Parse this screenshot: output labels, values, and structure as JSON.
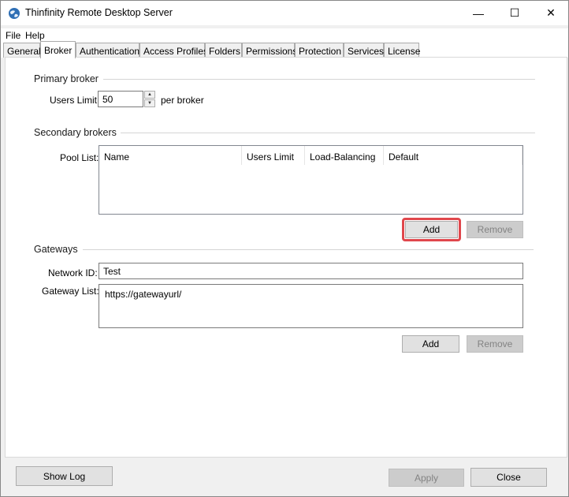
{
  "window": {
    "title": "Thinfinity Remote Desktop Server",
    "icon": "thinfinity-globe-icon",
    "controls": {
      "minimize": "—",
      "maximize": "☐",
      "close": "✕"
    }
  },
  "menu": [
    {
      "label": "File"
    },
    {
      "label": "Help"
    }
  ],
  "tabs": [
    {
      "label": "General"
    },
    {
      "label": "Broker",
      "active": true
    },
    {
      "label": "Authentication"
    },
    {
      "label": "Access Profiles"
    },
    {
      "label": "Folders"
    },
    {
      "label": "Permissions"
    },
    {
      "label": "Protection"
    },
    {
      "label": "Services"
    },
    {
      "label": "License"
    }
  ],
  "primary_broker": {
    "heading": "Primary broker",
    "users_limit_label": "Users Limit:",
    "users_limit_value": "50",
    "suffix": "per broker"
  },
  "secondary_brokers": {
    "heading": "Secondary brokers",
    "pool_list_label": "Pool List:",
    "columns": [
      "Name",
      "Users Limit",
      "Load-Balancing",
      "Default"
    ],
    "rows": [],
    "add_label": "Add",
    "remove_label": "Remove",
    "highlight_color": "#e0474c"
  },
  "gateways": {
    "heading": "Gateways",
    "network_id_label": "Network ID:",
    "network_id_value": "Test",
    "gateway_list_label": "Gateway List:",
    "gateway_list_value": "https://gatewayurl/",
    "add_label": "Add",
    "remove_label": "Remove"
  },
  "footer": {
    "show_log": "Show Log",
    "apply": "Apply",
    "close": "Close"
  }
}
